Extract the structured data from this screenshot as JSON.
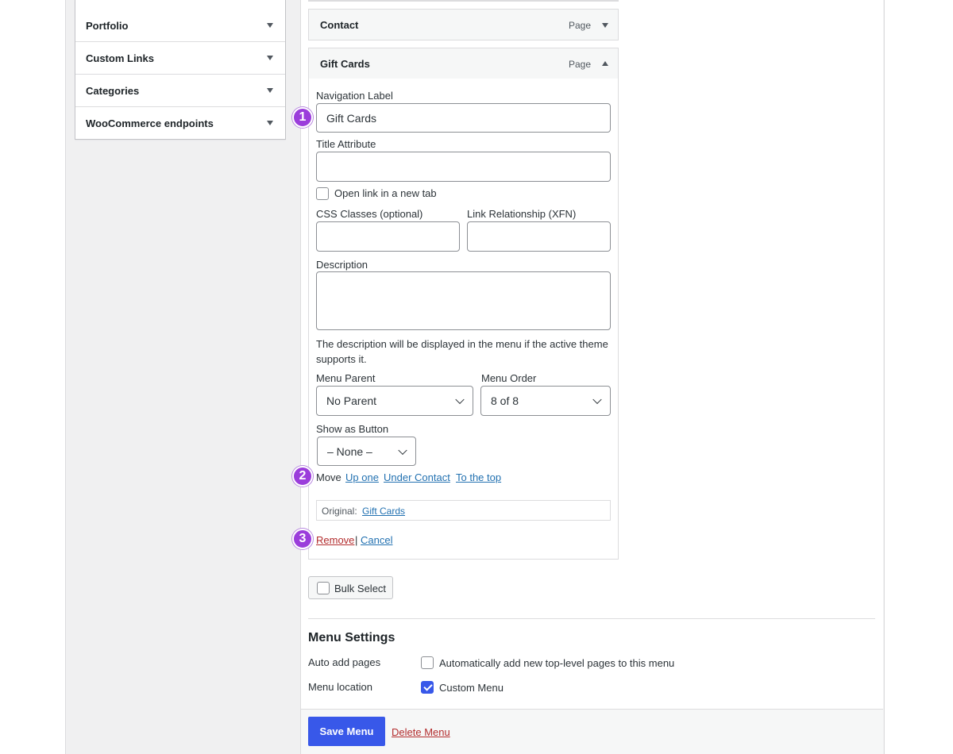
{
  "sidebar": {
    "items": [
      {
        "label": "Portfolio"
      },
      {
        "label": "Custom Links"
      },
      {
        "label": "Categories"
      },
      {
        "label": "WooCommerce endpoints"
      }
    ]
  },
  "menu_items": [
    {
      "title": "Contact",
      "type": "Page"
    },
    {
      "title": "Gift Cards",
      "type": "Page"
    }
  ],
  "item_settings": {
    "nav_label": {
      "label": "Navigation Label",
      "value": "Gift Cards"
    },
    "title_attr": {
      "label": "Title Attribute",
      "value": ""
    },
    "new_tab": {
      "label": "Open link in a new tab",
      "checked": false
    },
    "css_classes": {
      "label": "CSS Classes (optional)"
    },
    "xfn": {
      "label": "Link Relationship (XFN)"
    },
    "description": {
      "label": "Description",
      "help": "The description will be displayed in the menu if the active theme supports it."
    },
    "menu_parent": {
      "label": "Menu Parent",
      "value": "No Parent"
    },
    "menu_order": {
      "label": "Menu Order",
      "value": "8 of 8"
    },
    "show_button": {
      "label": "Show as Button",
      "value": "– None –"
    },
    "move": {
      "label": "Move",
      "links": [
        "Up one",
        "Under Contact",
        "To the top"
      ]
    },
    "original": {
      "label": "Original:",
      "link": "Gift Cards"
    },
    "remove": "Remove",
    "separator": "|",
    "cancel": "Cancel"
  },
  "badges": [
    "1",
    "2",
    "3"
  ],
  "bulk_select": "Bulk Select",
  "menu_settings": {
    "heading": "Menu Settings",
    "auto_add": {
      "label": "Auto add pages",
      "option": "Automatically add new top-level pages to this menu",
      "checked": false
    },
    "location": {
      "label": "Menu location",
      "option": "Custom Menu",
      "checked": true
    }
  },
  "footer": {
    "save": "Save Menu",
    "delete": "Delete Menu"
  },
  "colors": {
    "accent": "#3858e9",
    "link": "#2271b1",
    "danger": "#b32d2e",
    "badge": "#9b3ddb"
  }
}
